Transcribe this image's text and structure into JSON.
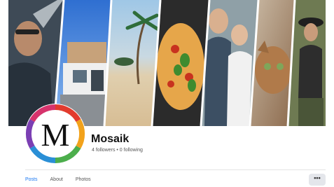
{
  "page": {
    "name": "Mosaik",
    "stats": "4 followers • 0 following",
    "avatar_letter": "M"
  },
  "tabs": [
    {
      "label": "Posts",
      "active": true
    },
    {
      "label": "About",
      "active": false
    },
    {
      "label": "Photos",
      "active": false
    }
  ],
  "more_button": {
    "label": "•••"
  },
  "cover": {
    "panels": [
      "man-with-glasses-photo",
      "modern-house-photo",
      "beach-palm-photo",
      "pasta-dish-photo",
      "laughing-couple-photo",
      "cat-photo",
      "woman-with-hat-photo"
    ]
  },
  "colors": {
    "accent": "#1877f2",
    "avatar_ring": [
      "#e23b2e",
      "#f2a21b",
      "#4cae4c",
      "#2a8fd6",
      "#7b3fb3",
      "#d6336c"
    ]
  }
}
